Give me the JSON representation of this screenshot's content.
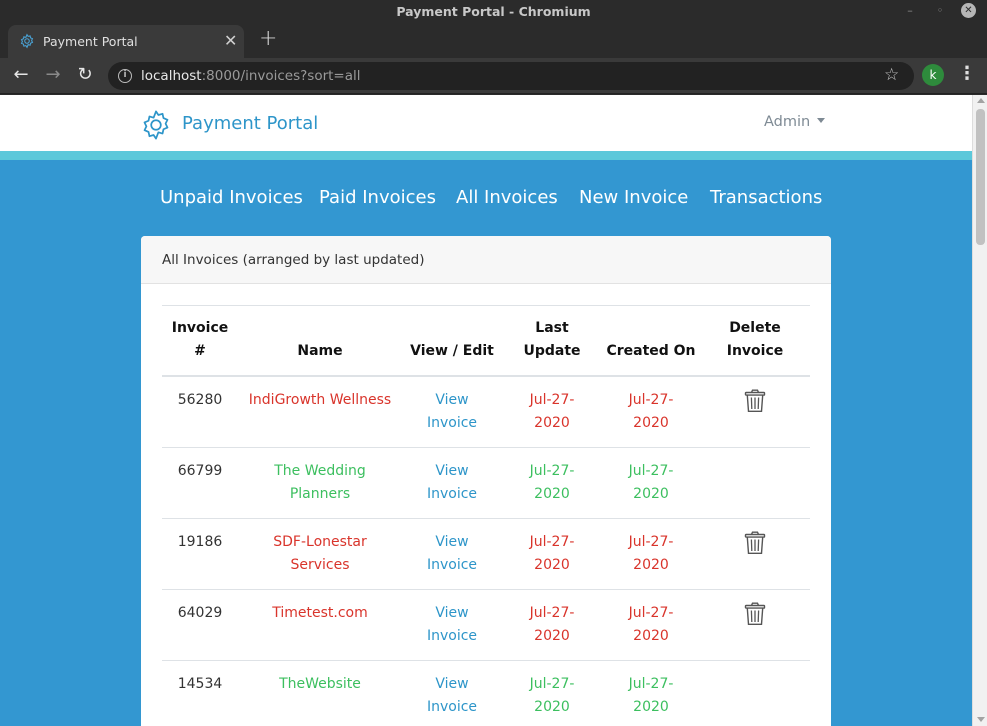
{
  "window": {
    "title": "Payment Portal - Chromium",
    "min": "–",
    "max": "◦",
    "close": "✕"
  },
  "tab": {
    "title": "Payment Portal",
    "close": "✕",
    "new": "+"
  },
  "toolbar": {
    "back": "←",
    "forward": "→",
    "reload": "↻",
    "url_host": "localhost",
    "url_rest": ":8000/invoices?sort=all",
    "star": "☆",
    "profile_initial": "k",
    "menu": "⋮"
  },
  "header": {
    "brand": "Payment Portal",
    "admin": "Admin"
  },
  "nav": {
    "items": [
      {
        "label": "Unpaid Invoices"
      },
      {
        "label": "Paid Invoices"
      },
      {
        "label": "All Invoices"
      },
      {
        "label": "New Invoice"
      },
      {
        "label": "Transactions"
      }
    ]
  },
  "card": {
    "title": "All Invoices (arranged by last updated)"
  },
  "table": {
    "headers": {
      "invoice_l1": "Invoice",
      "invoice_l2": "#",
      "name": "Name",
      "view": "View / Edit",
      "last_l1": "Last",
      "last_l2": "Update",
      "created": "Created On",
      "delete_l1": "Delete",
      "delete_l2": "Invoice"
    },
    "rows": [
      {
        "num": "56280",
        "name": "IndiGrowth Wellness",
        "view_l1": "View",
        "view_l2": "Invoice",
        "updated_l1": "Jul-27-",
        "updated_l2": "2020",
        "created_l1": "Jul-27-",
        "created_l2": "2020",
        "status": "red",
        "deletable": true
      },
      {
        "num": "66799",
        "name": "The Wedding Planners",
        "view_l1": "View",
        "view_l2": "Invoice",
        "updated_l1": "Jul-27-",
        "updated_l2": "2020",
        "created_l1": "Jul-27-",
        "created_l2": "2020",
        "status": "green",
        "deletable": false
      },
      {
        "num": "19186",
        "name": "SDF-Lonestar Services",
        "view_l1": "View",
        "view_l2": "Invoice",
        "updated_l1": "Jul-27-",
        "updated_l2": "2020",
        "created_l1": "Jul-27-",
        "created_l2": "2020",
        "status": "red",
        "deletable": true
      },
      {
        "num": "64029",
        "name": "Timetest.com",
        "view_l1": "View",
        "view_l2": "Invoice",
        "updated_l1": "Jul-27-",
        "updated_l2": "2020",
        "created_l1": "Jul-27-",
        "created_l2": "2020",
        "status": "red",
        "deletable": true
      },
      {
        "num": "14534",
        "name": "TheWebsite",
        "view_l1": "View",
        "view_l2": "Invoice",
        "updated_l1": "Jul-27-",
        "updated_l2": "2020",
        "created_l1": "Jul-27-",
        "created_l2": "2020",
        "status": "green",
        "deletable": false
      }
    ]
  },
  "colors": {
    "page_bg": "#3397d1",
    "brand": "#2d95c9",
    "stripe": "#5cc8da",
    "unpaid": "#d9342b",
    "paid": "#3cbf5f"
  }
}
